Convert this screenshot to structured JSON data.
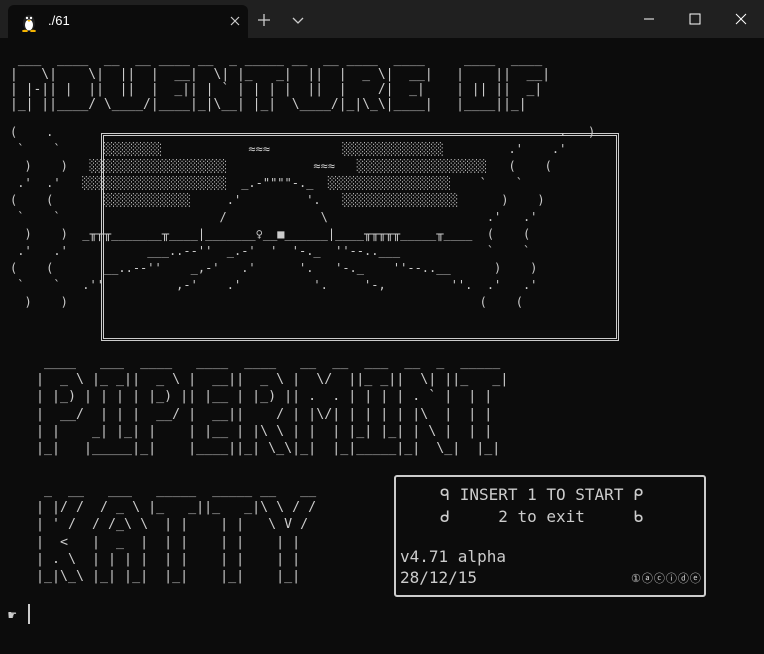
{
  "window": {
    "tab_title": "./61",
    "tab_icon": "linux-penguin-icon",
    "controls": [
      "minimize-icon",
      "maximize-icon",
      "close-icon"
    ],
    "colors": {
      "titlebar": "#202020",
      "terminal_bg": "#0c0c0c",
      "text": "#cccccc"
    }
  },
  "terminal": {
    "art_title": " ___  ____  __  __ ____ __  _ _____ __  __ ____  ____     ____  ____\n|   \\|    \\|  ||  |  __|  \\| |_   _|  ||  |  _ \\|  __|   |    ||  __|\n| |-|| |  ||  ||  |  _|| | ` | | | |  ||  |    /|  _|    | || ||  _|\n|_| ||____/ \\____/|____|_|\\__| |_|  \\____/|_|\\_\\|____|   |____||_|",
    "art_scene": "(    .                                                                      .   )\n `    `      ░░░░░░░░            ≈≈≈          ░░░░░░░░░░░░░░         .'    .'\n  )    )   ░░░░░░░░░░░░░░░░░░░            ≈≈≈   ░░░░░░░░░░░░░░░░░░   (    (\n .'  .'   ░░░░░░░░░░░░░░░░░░░░  _.-\"\"\"\"-._  ░░░░░░░░░░░░░░░░░    `    `\n(    (       ░░░░░░░░░░░░     .'         '.   ░░░░░░░░░░░░░░░░      )    )\n `    `                      /             \\                      .'   .'\n  )    )  _╥╥╥_______╥____|_______♀__■______|____╥╥╥╥╥_____╥____  (    (\n .'   .'           ___..--''  _.-'  '  '-._  ''--..___            `    `\n(    (       __..--''    _,-'   .'      '.   '-._    ''--..__      )    )\n `    `   .''          ,-'    .'          '.     '-,         ''.  .'   .'\n  )    )                                                         (    (",
    "art_pipermint": " ____   ___  ____   ____  ____   __  __  ___  __  _  _____\n|  _ \\ |_ _||  _ \\ |  __||  _ \\ |  \\/  ||_ _||  \\| ||_   _|\n| |_) | | | | |_) || |__ | |_) || .  . | | | | . ` |  | |\n|  __/  | | |  __/ |  __||    / | |\\/| | | | | |\\  |  | |\n| |    _| |_| |    | |__ | |\\ \\ | |  | |_| |_| | \\ |  | |\n|_|   |_____|_|    |____||_| \\_\\|_|  |_|_____|_|  \\_|  |_|",
    "art_katty": " _  __   ___   _____  _____ __   __\n| |/ /  / _ \\ |_   _||_   _|\\ \\ / /\n| ' /  / /_\\ \\  | |    | |   \\ V /\n|  <   |  _  |  | |    | |    | |\n| . \\  | | | |  | |    | |    | |\n|_|\\_\\ |_| |_|  |_|    |_|    |_|",
    "menu": {
      "start_line": "ᑫ INSERT 1 TO START ᑭ",
      "exit_line": "ᑯ     2 to exit     ᑲ",
      "version": "v4.71 alpha",
      "date": "28/12/15",
      "marks": "①ⓐⓒⓘⓓⓔ"
    },
    "prompt_symbol": "☛"
  }
}
